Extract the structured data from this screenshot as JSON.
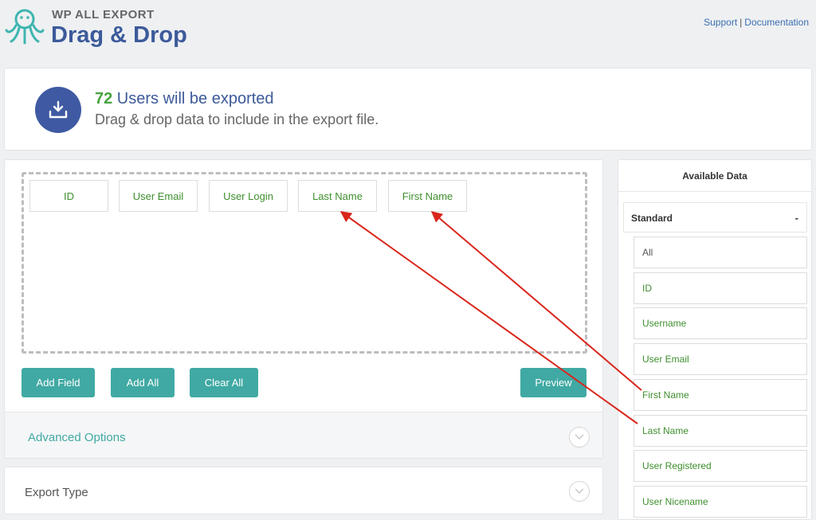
{
  "header": {
    "brand_top": "WP ALL EXPORT",
    "brand_main": "Drag & Drop",
    "links": {
      "support": "Support",
      "separator": "|",
      "documentation": "Documentation"
    }
  },
  "summary": {
    "count": "72",
    "line1_rest": " Users will be exported",
    "line2": "Drag & drop data to include in the export file."
  },
  "dropzone": {
    "fields": [
      "ID",
      "User Email",
      "User Login",
      "Last Name",
      "First Name"
    ]
  },
  "buttons": {
    "add_field": "Add Field",
    "add_all": "Add All",
    "clear_all": "Clear All",
    "preview": "Preview"
  },
  "sections": {
    "advanced": "Advanced Options",
    "export_type": "Export Type"
  },
  "sidebar": {
    "title": "Available Data",
    "group": "Standard",
    "group_toggle": "-",
    "items": [
      "All",
      "ID",
      "Username",
      "User Email",
      "First Name",
      "Last Name",
      "User Registered",
      "User Nicename"
    ]
  },
  "colors": {
    "accent": "#40a9a3",
    "brand": "#3c5a9a",
    "field_text": "#3e8f2e",
    "count": "#46a23e",
    "annotation_arrow": "#d9261c"
  },
  "icons": {
    "logo": "octopus-logo-icon",
    "download": "download-icon",
    "chevron": "chevron-down-icon"
  }
}
